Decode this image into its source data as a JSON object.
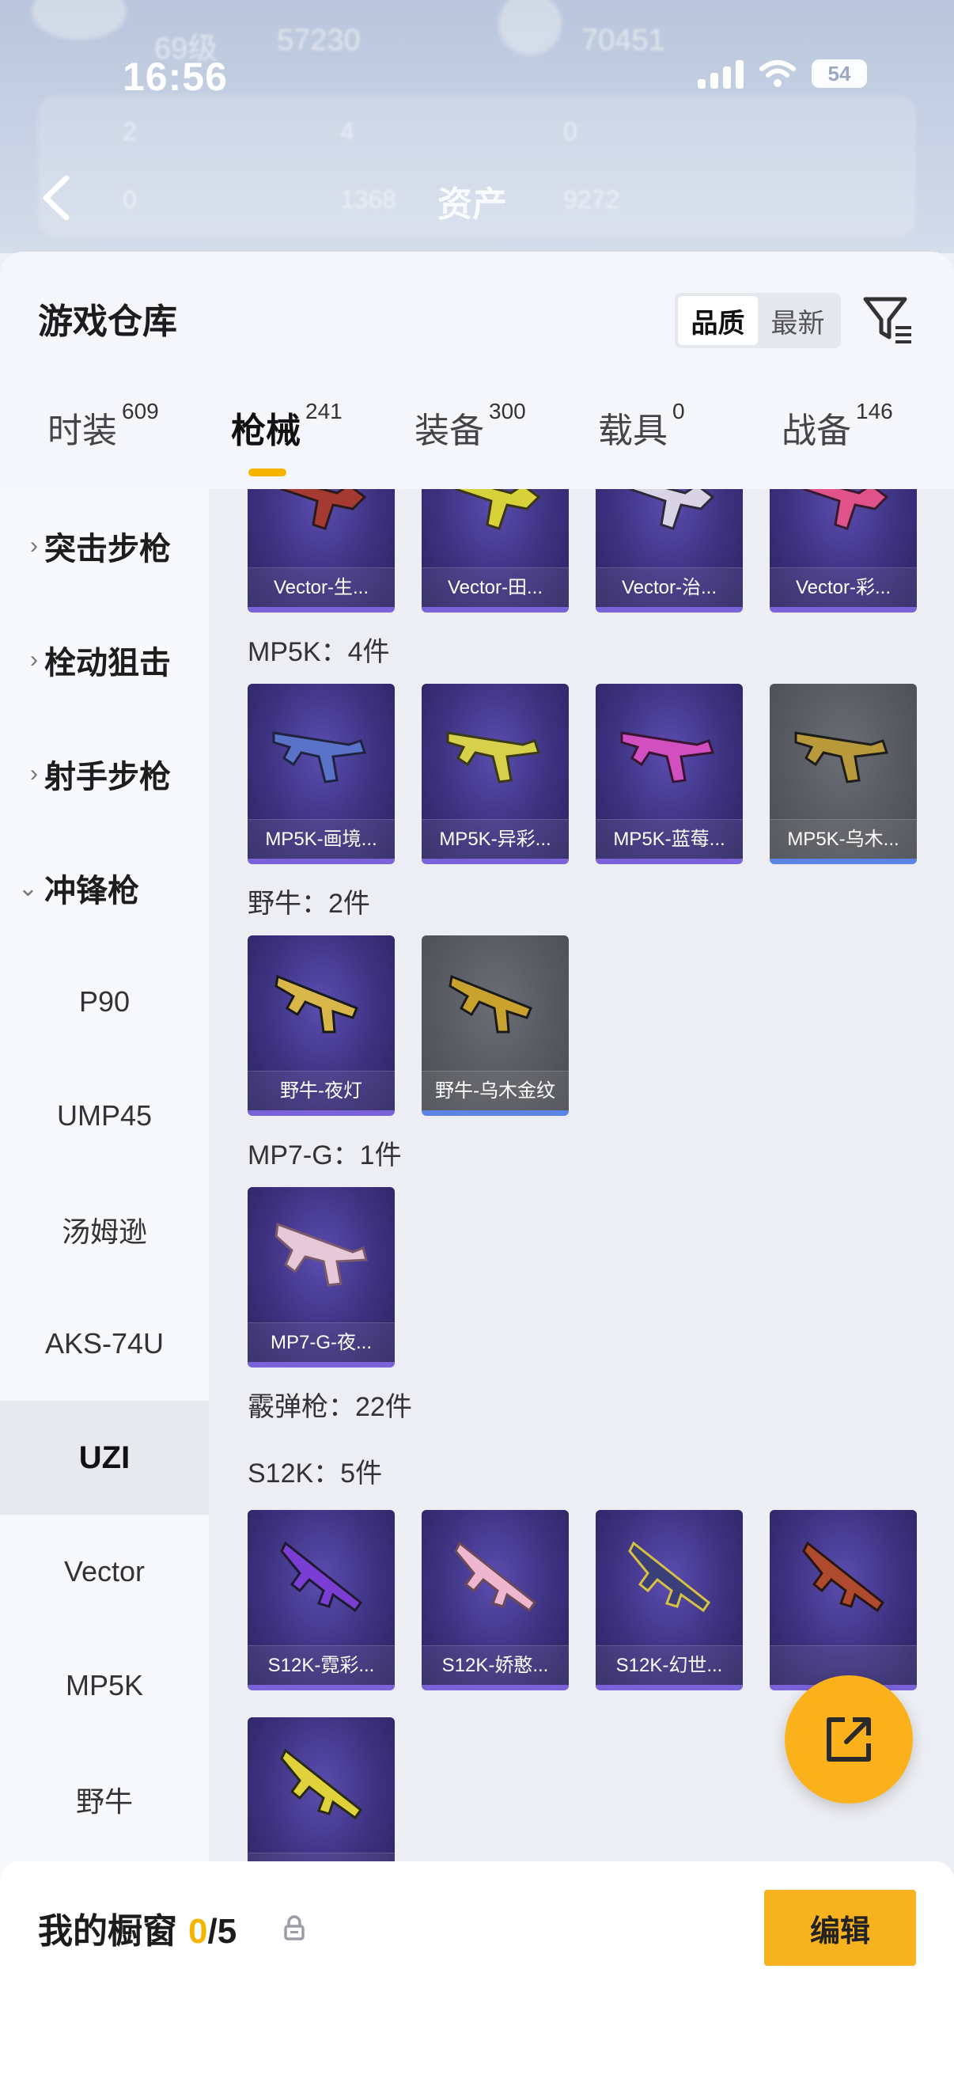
{
  "status": {
    "time": "16:56",
    "battery": "54"
  },
  "header": {
    "title": "资产",
    "ghost_texts": [
      "69级",
      "57230",
      "70451",
      "2",
      "4",
      "0",
      "1368",
      "9272",
      "0"
    ]
  },
  "warehouse": {
    "title": "游戏仓库",
    "sort_options": [
      "品质",
      "最新"
    ],
    "tabs": [
      {
        "label": "时装",
        "count": "609"
      },
      {
        "label": "枪械",
        "count": "241"
      },
      {
        "label": "装备",
        "count": "300"
      },
      {
        "label": "载具",
        "count": "0"
      },
      {
        "label": "战备",
        "count": "146"
      }
    ],
    "active_tab": "枪械"
  },
  "sidebar": {
    "categories": [
      {
        "label": "突击步枪",
        "arrow": "›"
      },
      {
        "label": "栓动狙击",
        "arrow": "›"
      },
      {
        "label": "射手步枪",
        "arrow": "›"
      },
      {
        "label": "冲锋枪",
        "arrow": "⌄"
      }
    ],
    "subitems": [
      "P90",
      "UMP45",
      "汤姆逊",
      "AKS-74U",
      "UZI",
      "Vector",
      "MP5K",
      "野牛"
    ],
    "active_subitem": "UZI"
  },
  "groups": [
    {
      "label": "",
      "items": [
        "Vector-生...",
        "Vector-田...",
        "Vector-治...",
        "Vector-彩..."
      ]
    },
    {
      "label": "MP5K：4件",
      "items": [
        "MP5K-画境...",
        "MP5K-异彩...",
        "MP5K-蓝莓...",
        "MP5K-乌木..."
      ]
    },
    {
      "label": "野牛：2件",
      "items": [
        "野牛-夜灯",
        "野牛-乌木金纹"
      ]
    },
    {
      "label": "MP7-G：1件",
      "items": [
        "MP7-G-夜..."
      ]
    },
    {
      "label": "霰弹枪：22件",
      "items": []
    },
    {
      "label": "S12K：5件",
      "items": [
        "S12K-霓彩...",
        "S12K-娇憨...",
        "S12K-幻世...",
        "",
        ""
      ]
    }
  ],
  "showcase": {
    "title": "我的橱窗",
    "current": "0",
    "separator": "/",
    "max": "5",
    "edit_label": "编辑"
  },
  "colors": {
    "accent": "#f4b400",
    "card_purple": "#3d317f",
    "card_grey": "#56585f",
    "fab": "#fbb11b"
  }
}
